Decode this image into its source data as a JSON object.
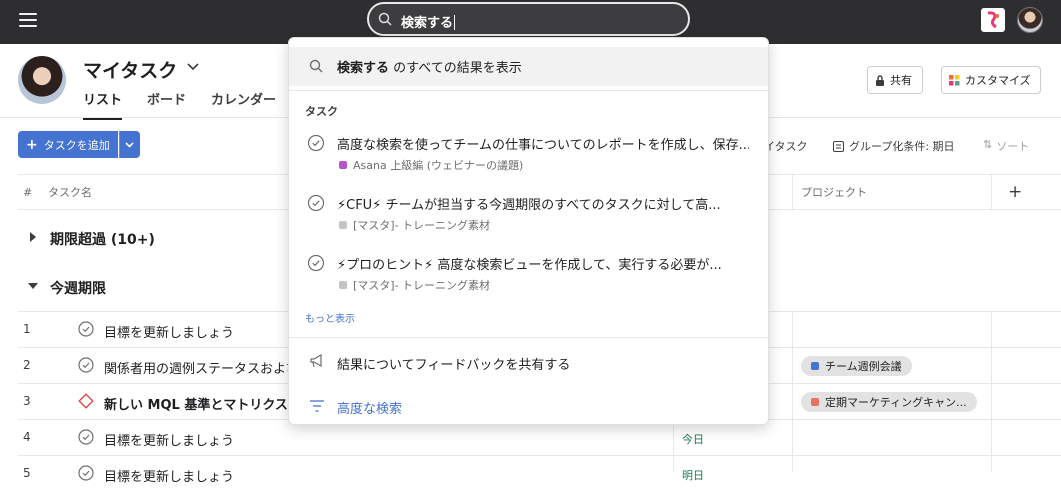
{
  "topbar": {
    "search_value": "検索する"
  },
  "header": {
    "title": "マイタスク",
    "tabs": [
      "リスト",
      "ボード",
      "カレンダー"
    ],
    "share_label": "共有",
    "customize_label": "カスタマイズ"
  },
  "toolbar": {
    "add_task_label": "タスクを追加",
    "mytask_label": "イタスク",
    "group_label": "グループ化条件: 期日",
    "sort_label": "ソート"
  },
  "columns": {
    "num": "#",
    "task_name": "タスク名",
    "project": "プロジェクト",
    "add": "+"
  },
  "sections": [
    {
      "title": "期限超過 (10+)"
    },
    {
      "title": "今週期限"
    }
  ],
  "rows": [
    {
      "num": "1",
      "name": "目標を更新しましょう",
      "due": "",
      "project": "",
      "project_color": ""
    },
    {
      "num": "2",
      "name": "関係者用の週例ステータスおよび",
      "due": "",
      "project": "チーム週例会議",
      "project_color": "#4573d2"
    },
    {
      "num": "3",
      "name": "新しい MQL 基準とマトリクスの",
      "due": "",
      "project": "定期マーケティングキャン...",
      "project_color": "#e8735e"
    },
    {
      "num": "4",
      "name": "目標を更新しましょう",
      "due": "今日",
      "project": "",
      "project_color": ""
    },
    {
      "num": "5",
      "name": "目標を更新しましょう",
      "due": "明日",
      "project": "",
      "project_color": ""
    }
  ],
  "dropdown": {
    "show_all_bold": "検索する",
    "show_all_rest": " のすべての結果を表示",
    "section_label": "タスク",
    "tasks": [
      {
        "title": "高度な検索を使ってチームの仕事についてのレポートを作成し、保存...",
        "sub": "Asana 上級編 (ウェビナーの議題)",
        "color": "#b656c9"
      },
      {
        "title": "⚡CFU⚡ チームが担当する今週期限のすべてのタスクに対して高...",
        "sub": "[マスタ]- トレーニング素材",
        "color": "#c4c4c4"
      },
      {
        "title": "⚡プロのヒント⚡ 高度な検索ビューを作成して、実行する必要が...",
        "sub": "[マスタ]- トレーニング素材",
        "color": "#c4c4c4"
      }
    ],
    "more_label": "もっと表示",
    "feedback_label": "結果についてフィードバックを共有する",
    "advanced_label": "高度な検索"
  }
}
